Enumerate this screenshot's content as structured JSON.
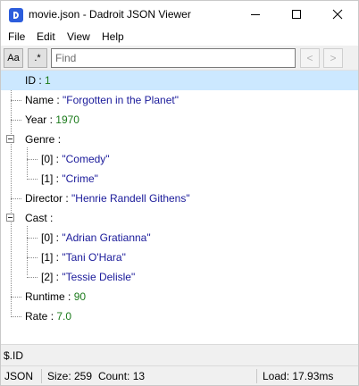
{
  "window": {
    "title": "movie.json - Dadroit JSON Viewer",
    "icon": "dadroit-app-icon"
  },
  "menu": [
    "File",
    "Edit",
    "View",
    "Help"
  ],
  "toolbar": {
    "match_case_label": "Aa",
    "regex_label": ".*",
    "find_placeholder": "Find",
    "find_value": "",
    "prev_label": "<",
    "next_label": ">"
  },
  "tree": {
    "id": {
      "key": "ID",
      "sep": " : ",
      "value": "1"
    },
    "name": {
      "key": "Name",
      "sep": " : ",
      "value": "\"Forgotten in the Planet\""
    },
    "year": {
      "key": "Year",
      "sep": " : ",
      "value": "1970"
    },
    "genre": {
      "key": "Genre",
      "sep": " :"
    },
    "genre_0": {
      "key": "[0]",
      "sep": "  : ",
      "value": "\"Comedy\""
    },
    "genre_1": {
      "key": "[1]",
      "sep": "  : ",
      "value": "\"Crime\""
    },
    "director": {
      "key": "Director",
      "sep": " : ",
      "value": "\"Henrie Randell Githens\""
    },
    "cast": {
      "key": "Cast",
      "sep": " :"
    },
    "cast_0": {
      "key": "[0]",
      "sep": "  : ",
      "value": "\"Adrian Gratianna\""
    },
    "cast_1": {
      "key": "[1]",
      "sep": " : ",
      "value": "\"Tani O'Hara\""
    },
    "cast_2": {
      "key": "[2]",
      "sep": "  : ",
      "value": "\"Tessie Delisle\""
    },
    "runtime": {
      "key": "Runtime",
      "sep": " : ",
      "value": "90"
    },
    "rate": {
      "key": "Rate",
      "sep": " : ",
      "value": "7.0"
    }
  },
  "path": "$.ID",
  "status": {
    "format": "JSON",
    "size": "Size: 259",
    "count": "Count: 13",
    "load": "Load: 17.93ms"
  },
  "colors": {
    "selection": "#cce8ff",
    "string_value": "#1a1a9a",
    "number_value": "#1b7a1b",
    "app_icon": "#2c5ddc"
  }
}
